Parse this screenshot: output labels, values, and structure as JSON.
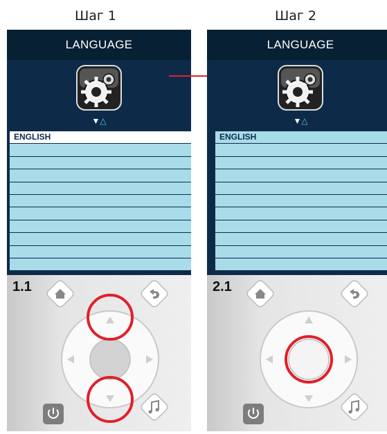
{
  "steps": [
    {
      "title": "Шаг 1",
      "header": "LANGUAGE",
      "list": [
        "ENGLISH",
        "",
        "",
        "",
        "",
        "",
        "",
        "",
        "",
        "",
        ""
      ],
      "selected_index": 0,
      "remote_label": "1.1",
      "highlighted_buttons": [
        "up-button",
        "down-button"
      ]
    },
    {
      "title": "Шаг 2",
      "header": "LANGUAGE",
      "list": [
        "ENGLISH",
        "",
        "",
        "",
        "",
        "",
        "",
        "",
        "",
        "",
        ""
      ],
      "selected_index": null,
      "remote_label": "2.1",
      "highlighted_buttons": [
        "ok-button"
      ]
    }
  ],
  "icons": {
    "settings": "gear-icon",
    "home": "home-icon",
    "back": "back-icon",
    "power": "power-icon",
    "music": "music-icon",
    "transition": "arrow-right-icon"
  },
  "colors": {
    "screen_bg": "#0d2b48",
    "list_item": "#a9dce9",
    "highlight": "#e0202a",
    "arrow": "#e0202a"
  }
}
